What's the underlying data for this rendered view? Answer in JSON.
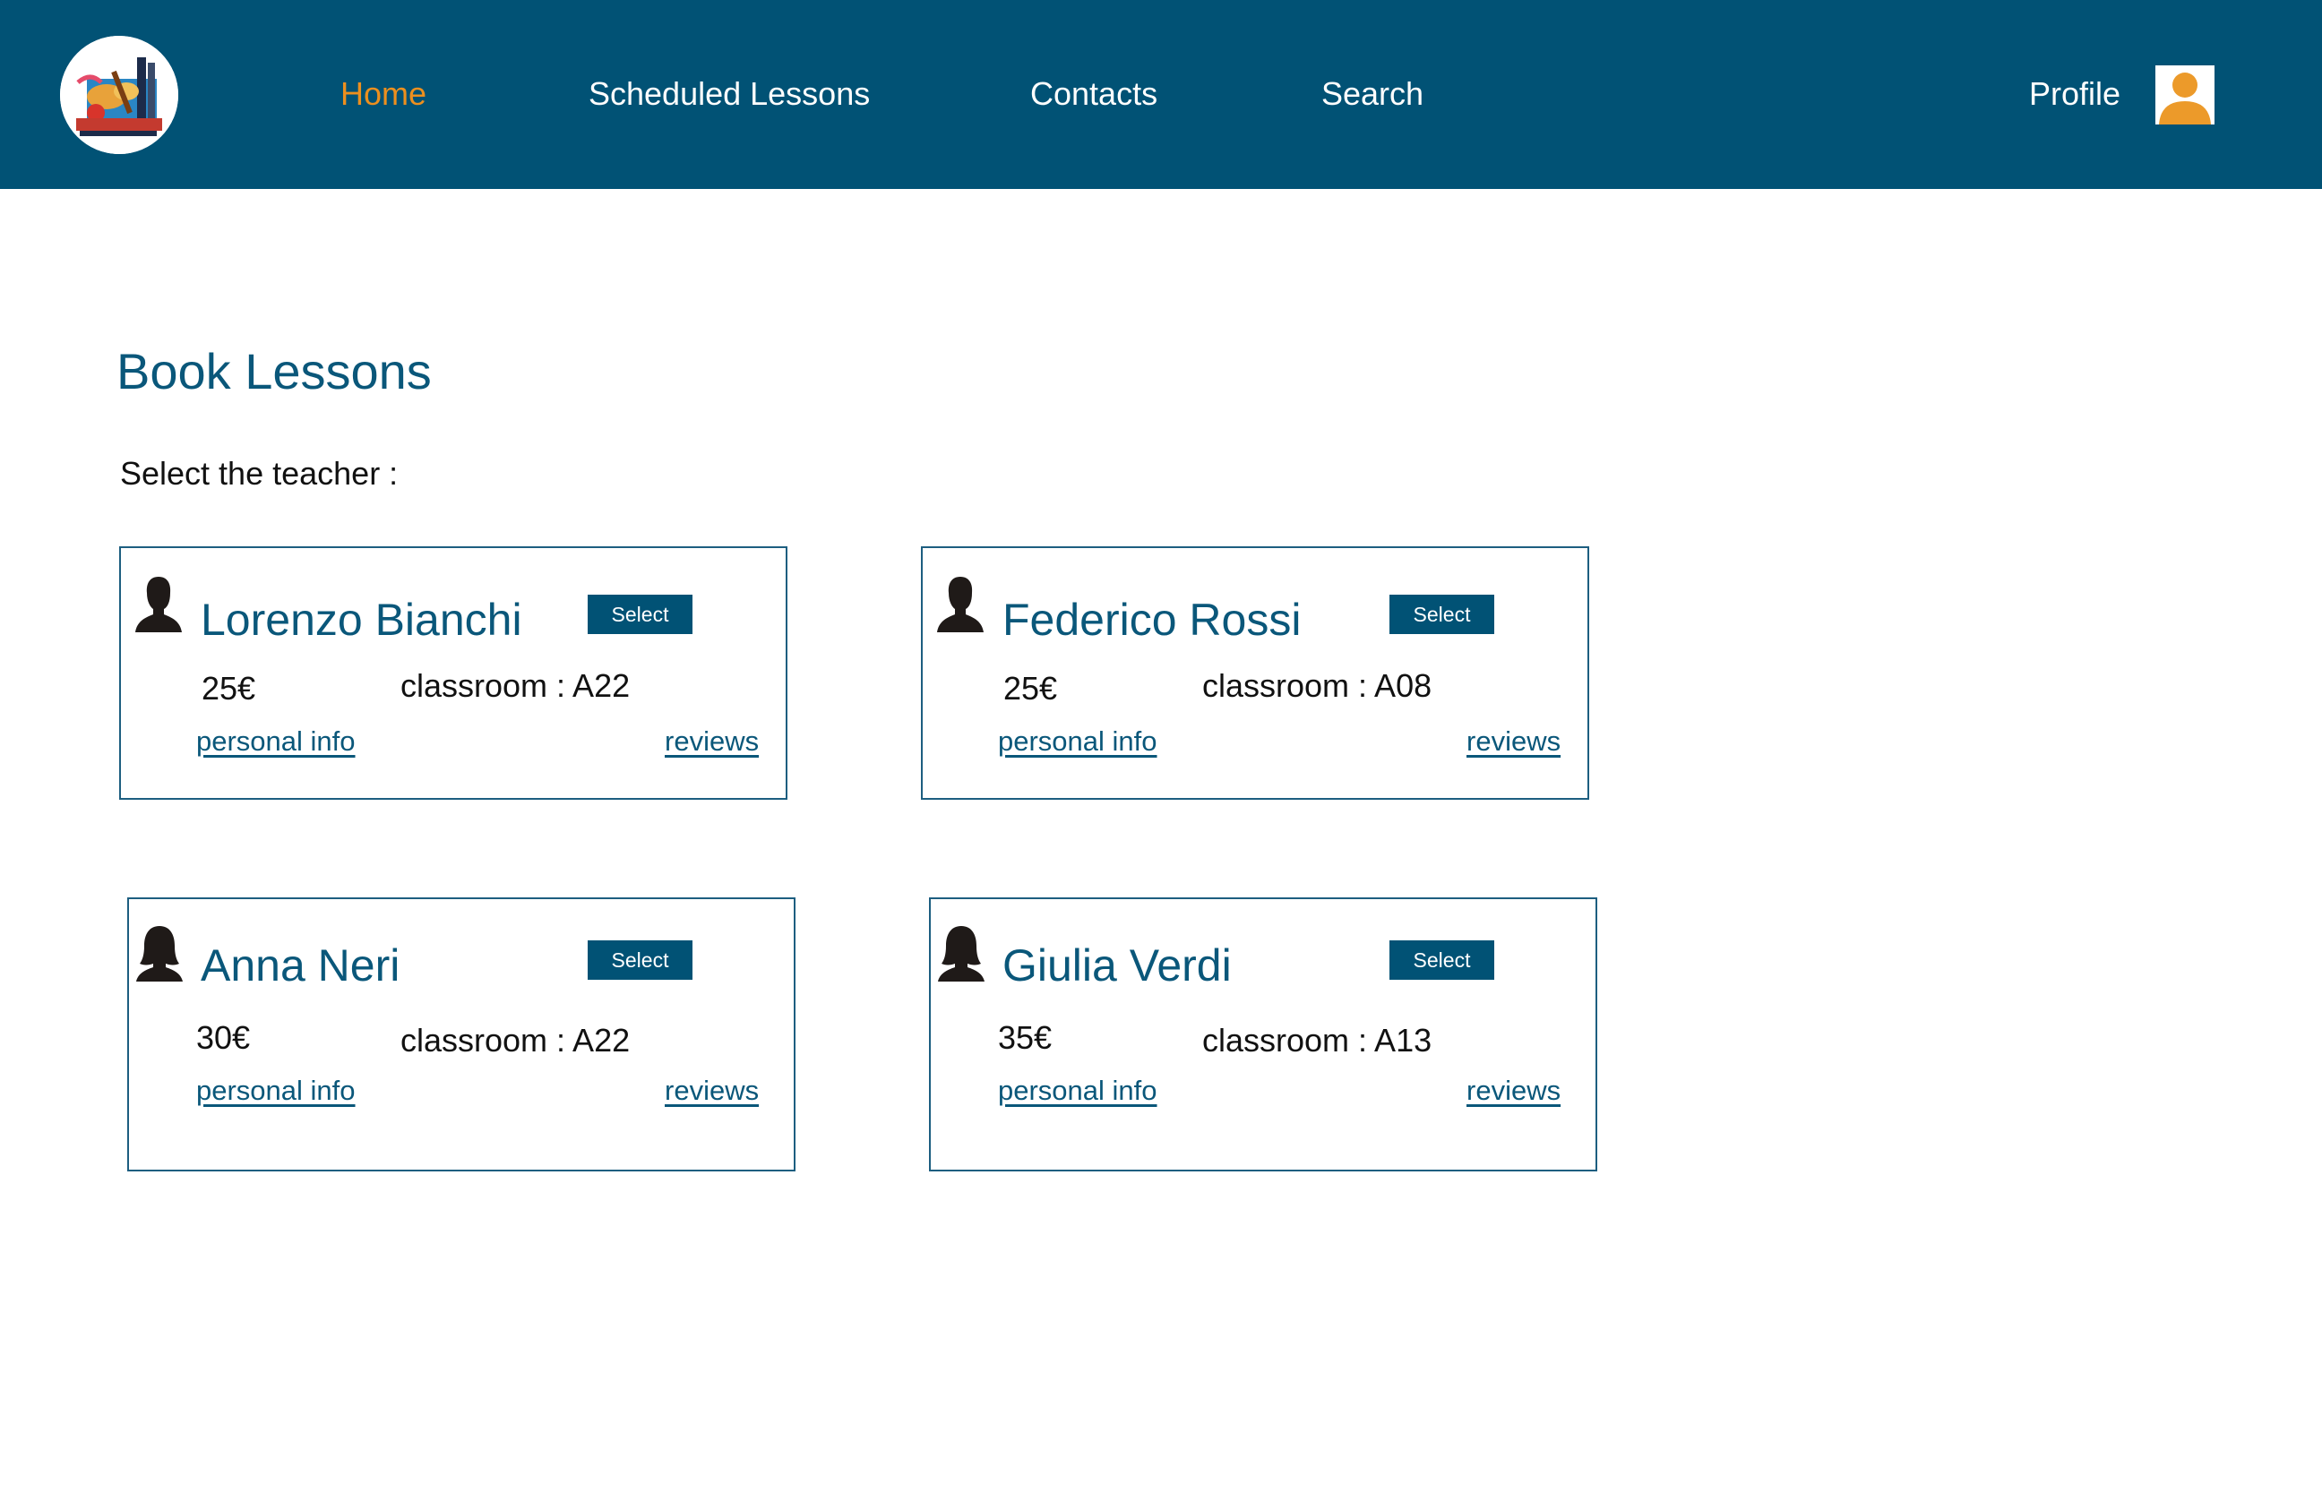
{
  "nav": {
    "logo": "music-school-logo",
    "links": [
      {
        "label": "Home",
        "active": true
      },
      {
        "label": "Scheduled Lessons",
        "active": false
      },
      {
        "label": "Contacts",
        "active": false
      },
      {
        "label": "Search",
        "active": false
      }
    ],
    "profile_label": "Profile",
    "profile_icon": "user-avatar-icon",
    "colors": {
      "background": "#015275",
      "active": "#ec8f1e",
      "text": "#ffffff"
    }
  },
  "main": {
    "title": "Book Lessons",
    "subtitle": "Select the teacher :"
  },
  "teachers": [
    {
      "name": "Lorenzo Bianchi",
      "gender": "male",
      "price": "25€",
      "classroom": "classroom : A22",
      "select_label": "Select",
      "personal_info_label": "personal info",
      "reviews_label": "reviews"
    },
    {
      "name": "Federico Rossi",
      "gender": "male",
      "price": "25€",
      "classroom": "classroom : A08",
      "select_label": "Select",
      "personal_info_label": "personal info",
      "reviews_label": "reviews"
    },
    {
      "name": "Anna Neri",
      "gender": "female",
      "price": "30€",
      "classroom": "classroom : A22",
      "select_label": "Select",
      "personal_info_label": "personal info",
      "reviews_label": "reviews"
    },
    {
      "name": "Giulia Verdi",
      "gender": "female",
      "price": "35€",
      "classroom": "classroom : A13",
      "select_label": "Select",
      "personal_info_label": "personal info",
      "reviews_label": "reviews"
    }
  ]
}
